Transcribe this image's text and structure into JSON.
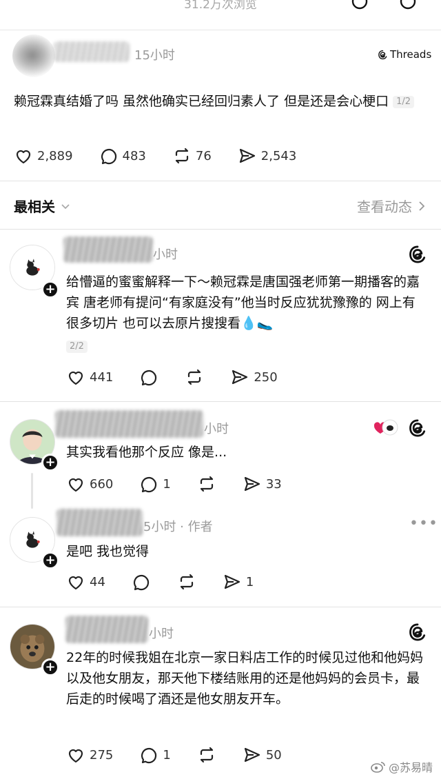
{
  "header": {
    "views": "31.2万次浏览"
  },
  "main_post": {
    "time": "15小时",
    "source": "Threads",
    "text": "赖冠霖真结婚了吗 虽然他确实已经回归素人了 但是还是会心梗口",
    "pager": "1/2",
    "likes": "2,889",
    "comments": "483",
    "reposts": "76",
    "shares": "2,543"
  },
  "sort": {
    "label": "最相关",
    "activity": "查看动态"
  },
  "replies": [
    {
      "time": "小时",
      "text": "给懵逼的蜜蜜解释一下～赖冠霖是唐国强老师第一期播客的嘉宾 唐老师有提问“有家庭没有”他当时反应犹犹豫豫的 网上有很多切片 也可以去原片搜搜看💧🥿",
      "pager": "2/2",
      "likes": "441",
      "shares": "250"
    },
    {
      "time": "小时",
      "text": "其实我看他那个反应 像是...",
      "likes": "660",
      "comments": "1",
      "shares": "33"
    },
    {
      "time": "5小时 · 作者",
      "text": "是吧 我也觉得",
      "likes": "44",
      "shares": "1"
    },
    {
      "time": "小时",
      "text": "22年的时候我姐在北京一家日料店工作的时候见过他和他妈妈以及他女朋友，那天他下楼结账用的还是他妈妈的会员卡，最后走的时候喝了酒还是他女朋友开车。",
      "likes": "275",
      "comments": "1",
      "shares": "50"
    }
  ],
  "watermark": "@苏易晴",
  "colors": {
    "text": "#111111",
    "muted": "#9a9a9a",
    "heart": "#e0245e"
  }
}
